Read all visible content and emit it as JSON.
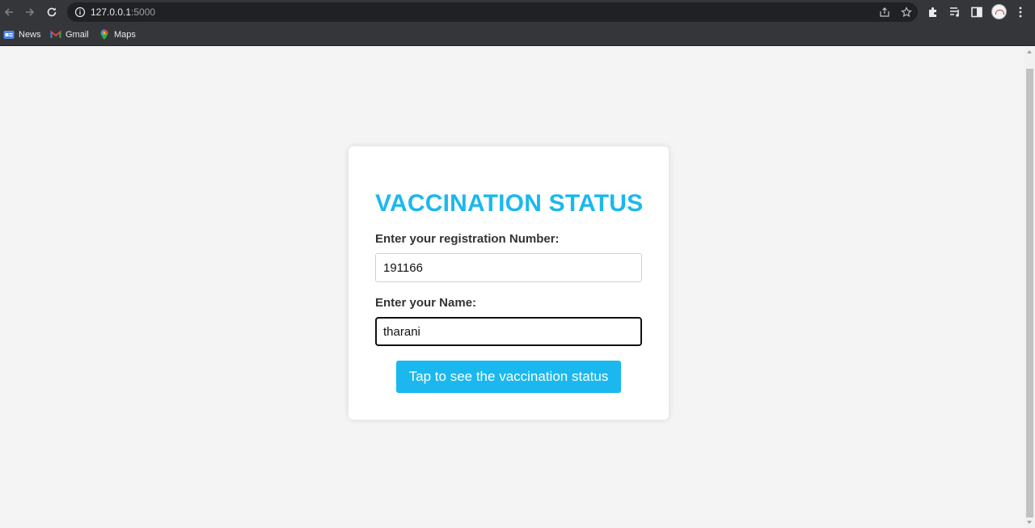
{
  "browser": {
    "url_host": "127.0.0.1",
    "url_port": ":5000",
    "bookmarks": [
      {
        "label": "News",
        "icon": "news-icon"
      },
      {
        "label": "Gmail",
        "icon": "gmail-icon"
      },
      {
        "label": "Maps",
        "icon": "maps-icon"
      }
    ]
  },
  "form": {
    "title": "VACCINATION STATUS",
    "registration_label": "Enter your registration Number:",
    "registration_value": "191166",
    "name_label": "Enter your Name:",
    "name_value": "tharani",
    "submit_label": "Tap to see the vaccination status"
  },
  "colors": {
    "accent": "#1ab8ef",
    "page_background": "#f4f4f4",
    "card_background": "#ffffff",
    "chrome_background": "#35363a"
  }
}
